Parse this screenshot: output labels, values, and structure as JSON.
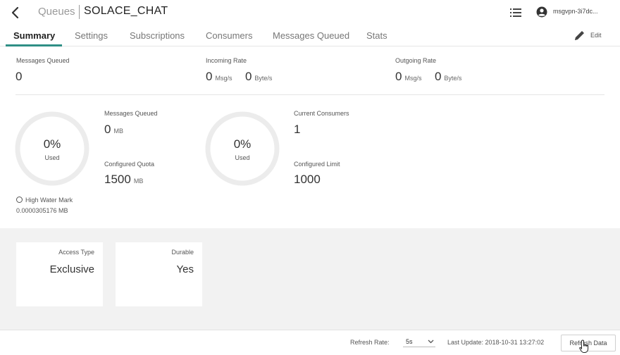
{
  "header": {
    "breadcrumb": "Queues",
    "title": "SOLACE_CHAT",
    "vpn_label": "msgvpn-3i7dc..."
  },
  "tabs": [
    {
      "label": "Summary",
      "active": true
    },
    {
      "label": "Settings"
    },
    {
      "label": "Subscriptions"
    },
    {
      "label": "Consumers"
    },
    {
      "label": "Messages Queued"
    },
    {
      "label": "Stats"
    }
  ],
  "edit_label": "Edit",
  "summary": {
    "messages_queued": {
      "label": "Messages Queued",
      "value": "0"
    },
    "incoming_rate": {
      "label": "Incoming Rate",
      "msg_value": "0",
      "msg_unit": "Msg/s",
      "byte_value": "0",
      "byte_unit": "Byte/s"
    },
    "outgoing_rate": {
      "label": "Outgoing Rate",
      "msg_value": "0",
      "msg_unit": "Msg/s",
      "byte_value": "0",
      "byte_unit": "Byte/s"
    }
  },
  "storage_gauge": {
    "percent": "0%",
    "used_label": "Used",
    "messages_queued_label": "Messages Queued",
    "messages_queued_value": "0",
    "messages_queued_unit": "MB",
    "quota_label": "Configured Quota",
    "quota_value": "1500",
    "quota_unit": "MB",
    "high_water_mark_label": "High Water Mark",
    "high_water_mark_value": "0.0000305176 MB"
  },
  "consumer_gauge": {
    "percent": "0%",
    "used_label": "Used",
    "current_label": "Current Consumers",
    "current_value": "1",
    "limit_label": "Configured Limit",
    "limit_value": "1000"
  },
  "properties": [
    {
      "label": "Access Type",
      "value": "Exclusive"
    },
    {
      "label": "Durable",
      "value": "Yes"
    }
  ],
  "footer": {
    "refresh_rate_label": "Refresh Rate:",
    "refresh_rate_value": "5s",
    "last_update": "Last Update: 2018-10-31 13:27:02",
    "refresh_button": "Refresh Data"
  },
  "colors": {
    "accent": "#2f8f86",
    "gauge_track": "#ececec",
    "band_bg": "#f2f2f2"
  }
}
